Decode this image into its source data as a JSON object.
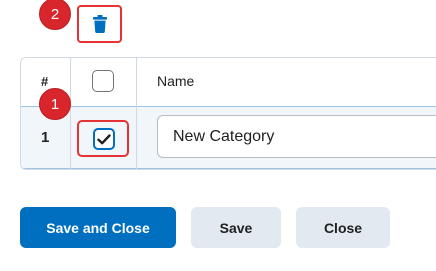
{
  "toolbar": {
    "delete_icon": "trash-icon",
    "callout": "2"
  },
  "table": {
    "headers": {
      "number": "#",
      "name": "Name"
    },
    "rows": [
      {
        "number": "1",
        "selected": true,
        "name_value": "New Category",
        "callout": "1"
      }
    ]
  },
  "footer": {
    "save_and_close_label": "Save and Close",
    "save_label": "Save",
    "close_label": "Close"
  },
  "colors": {
    "primary": "#006fbf",
    "callout": "#d9262c",
    "highlight_border": "#e53333",
    "selected_row": "#f1f6fb",
    "secondary_button": "#e3e9f1"
  }
}
